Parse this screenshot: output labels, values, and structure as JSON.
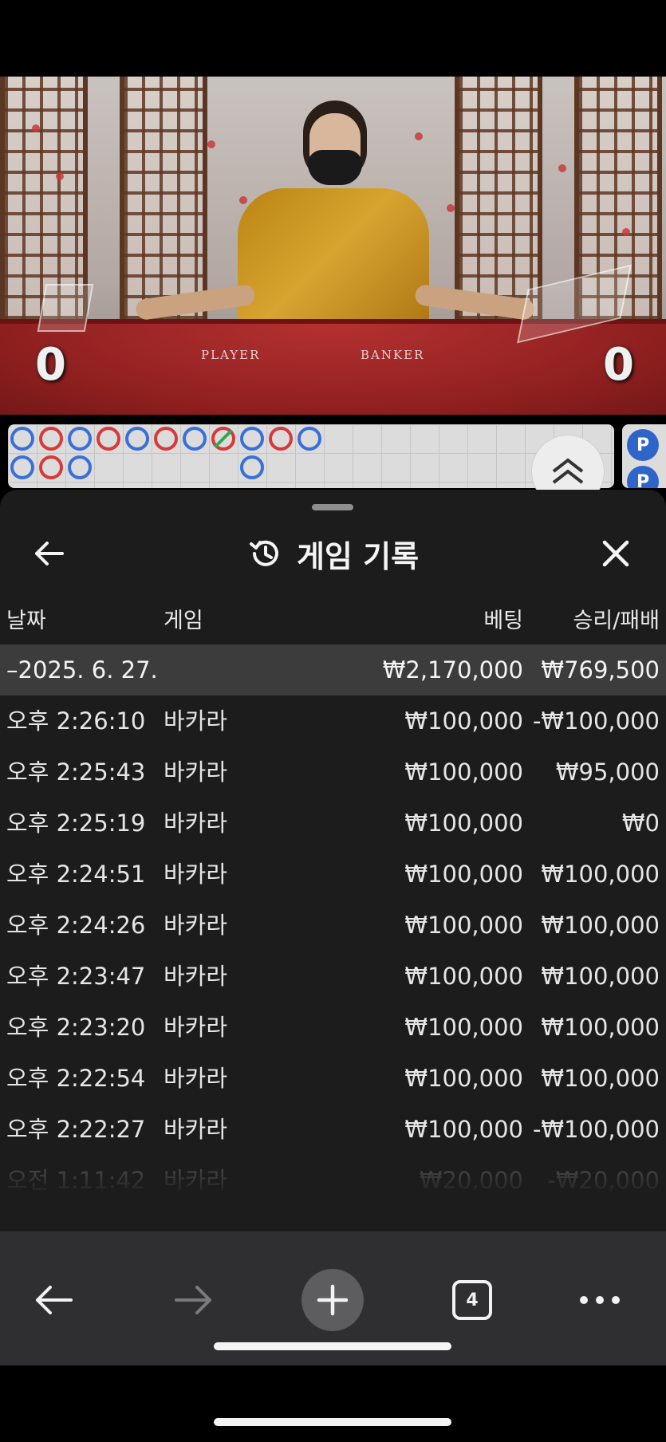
{
  "video": {
    "player_label": "PLAYER",
    "banker_label": "BANKER",
    "player_score": "0",
    "banker_score": "0"
  },
  "roadmap": {
    "side_badge_label": "P"
  },
  "sheet": {
    "title": "게임 기록",
    "columns": {
      "date": "날짜",
      "game": "게임",
      "bet": "베팅",
      "win_loss": "승리/패배"
    },
    "day_group": {
      "date": "–2025. 6. 27.",
      "bet_total": "₩2,170,000",
      "win_loss_total": "₩769,500"
    },
    "rows": [
      {
        "time": "오후 2:26:10",
        "game": "바카라",
        "bet": "₩100,000",
        "result": "-₩100,000"
      },
      {
        "time": "오후 2:25:43",
        "game": "바카라",
        "bet": "₩100,000",
        "result": "₩95,000"
      },
      {
        "time": "오후 2:25:19",
        "game": "바카라",
        "bet": "₩100,000",
        "result": "₩0"
      },
      {
        "time": "오후 2:24:51",
        "game": "바카라",
        "bet": "₩100,000",
        "result": "₩100,000"
      },
      {
        "time": "오후 2:24:26",
        "game": "바카라",
        "bet": "₩100,000",
        "result": "₩100,000"
      },
      {
        "time": "오후 2:23:47",
        "game": "바카라",
        "bet": "₩100,000",
        "result": "₩100,000"
      },
      {
        "time": "오후 2:23:20",
        "game": "바카라",
        "bet": "₩100,000",
        "result": "₩100,000"
      },
      {
        "time": "오후 2:22:54",
        "game": "바카라",
        "bet": "₩100,000",
        "result": "₩100,000"
      },
      {
        "time": "오후 2:22:27",
        "game": "바카라",
        "bet": "₩100,000",
        "result": "-₩100,000"
      },
      {
        "time": "오전 1:11:42",
        "game": "바카라",
        "bet": "₩20,000",
        "result": "-₩20,000"
      }
    ]
  },
  "toolbar": {
    "tab_count": "4"
  },
  "icons": {
    "back": "arrow-left-icon",
    "forward": "arrow-right-icon",
    "new_tab": "plus-icon",
    "tabs": "tabs-icon",
    "more": "more-horizontal-icon",
    "history": "history-icon",
    "close": "close-icon",
    "roadmap_expand": "chevron-double-up-icon"
  },
  "colors": {
    "sheet_bg": "#1c1c1c",
    "day_row_bg": "#3c3c3c",
    "toolbar_bg": "#2f2f31",
    "bead_blue": "#3a6fd8",
    "bead_red": "#d63a3a"
  }
}
